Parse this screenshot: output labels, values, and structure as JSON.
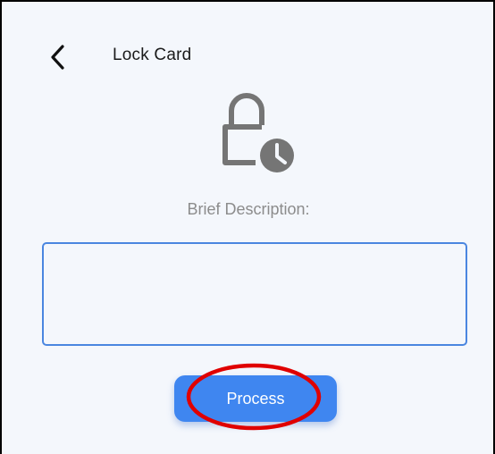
{
  "header": {
    "back_icon": "chevron-left-icon",
    "title": "Lock Card"
  },
  "main": {
    "icon": "lock-clock-icon",
    "description_label": "Brief Description:",
    "description_value": "",
    "process_label": "Process"
  },
  "annotation": {
    "shape": "ellipse",
    "color": "#e00000"
  },
  "colors": {
    "background": "#f4f7fc",
    "accent": "#3f86f0",
    "input_border": "#4a86e0",
    "icon": "#757575"
  }
}
